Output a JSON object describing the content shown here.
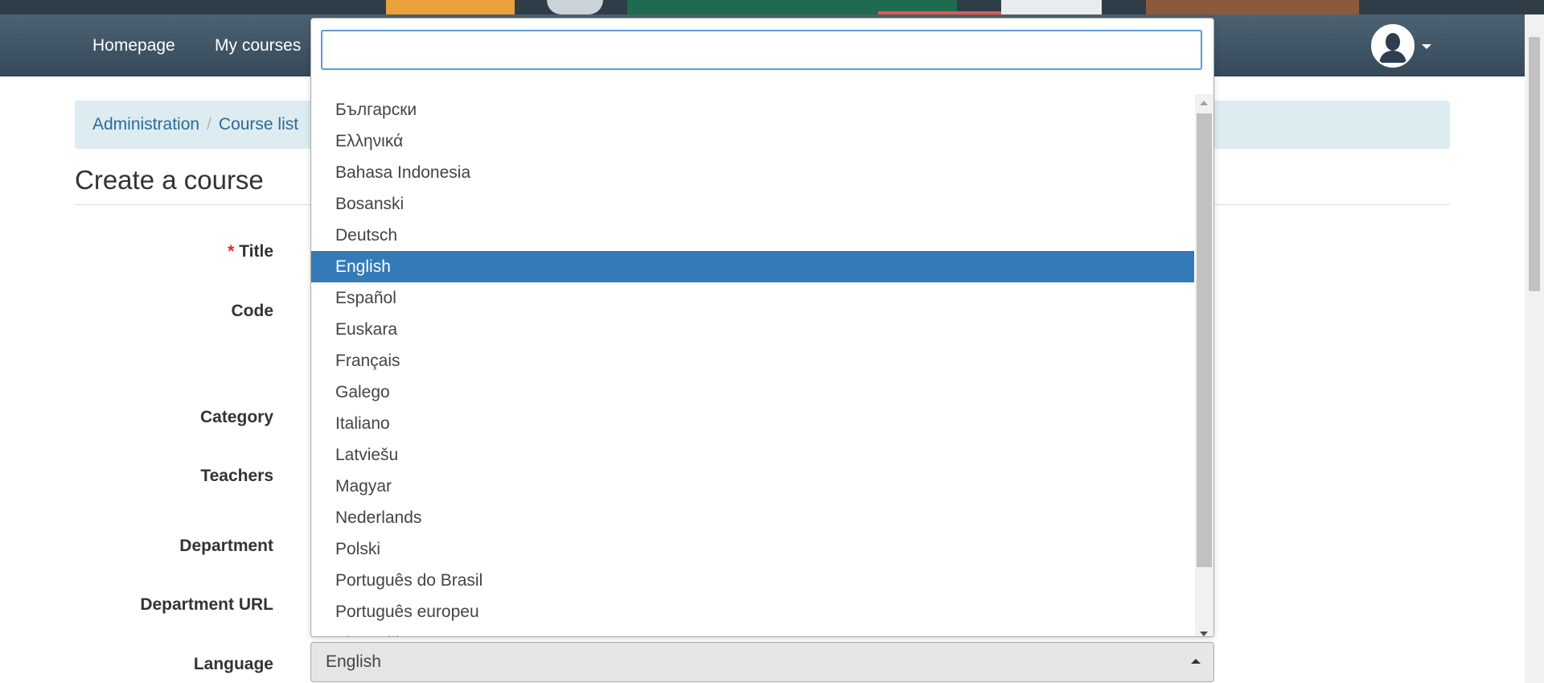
{
  "nav": {
    "links": [
      "Homepage",
      "My courses"
    ],
    "user_menu_icon": "user-avatar-icon"
  },
  "breadcrumb": [
    "Administration",
    "Course list"
  ],
  "page_title": "Create a course",
  "form": {
    "labels": {
      "title": "Title",
      "code": "Code",
      "category": "Category",
      "teachers": "Teachers",
      "department": "Department",
      "department_url": "Department URL",
      "language": "Language"
    },
    "required_marker": "*",
    "language_value": "English"
  },
  "dropdown": {
    "search_value": "",
    "options": [
      "Български",
      "Ελληνικά",
      "Bahasa Indonesia",
      "Bosanski",
      "Deutsch",
      "English",
      "Español",
      "Euskara",
      "Français",
      "Galego",
      "Italiano",
      "Latviešu",
      "Magyar",
      "Nederlands",
      "Polski",
      "Português do Brasil",
      "Português europeu",
      "Slovenčina"
    ],
    "selected": "English"
  },
  "colors": {
    "navbar": "#3f5463",
    "selected_option": "#337ab7",
    "breadcrumb_bg": "#dcecf1",
    "link": "#2d6a96",
    "required": "#d9262c"
  }
}
